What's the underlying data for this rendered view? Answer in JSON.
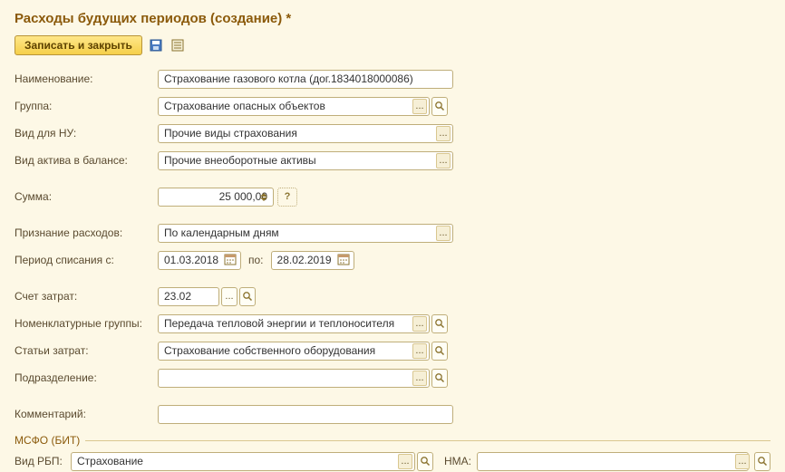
{
  "header": {
    "title": "Расходы будущих периодов (создание) *"
  },
  "toolbar": {
    "save_close_label": "Записать и закрыть"
  },
  "labels": {
    "name": "Наименование:",
    "group": "Группа:",
    "nu_type": "Вид для НУ:",
    "balance_asset_type": "Вид актива в балансе:",
    "amount": "Сумма:",
    "recognition": "Признание расходов:",
    "period_from": "Период списания с:",
    "period_to": "по:",
    "cost_account": "Счет затрат:",
    "nomenclature_groups": "Номенклатурные группы:",
    "cost_items": "Статьи затрат:",
    "department": "Подразделение:",
    "comment": "Комментарий:",
    "msfo_section": "МСФО (БИТ)",
    "rbp_type": "Вид РБП:",
    "nma": "НМА:"
  },
  "fields": {
    "name": "Страхование газового котла (дог.1834018000086)",
    "group": "Страхование опасных объектов",
    "nu_type": "Прочие виды страхования",
    "balance_asset_type": "Прочие внеоборотные активы",
    "amount": "25 000,00",
    "recognition": "По календарным дням",
    "period_from": "01.03.2018",
    "period_to": "28.02.2019",
    "cost_account": "23.02",
    "nomenclature_groups": "Передача тепловой энергии и теплоносителя",
    "cost_items": "Страхование собственного оборудования",
    "department": "",
    "comment": "",
    "rbp_type": "Страхование",
    "nma": ""
  },
  "icons": {
    "dots": "...",
    "help": "?"
  }
}
